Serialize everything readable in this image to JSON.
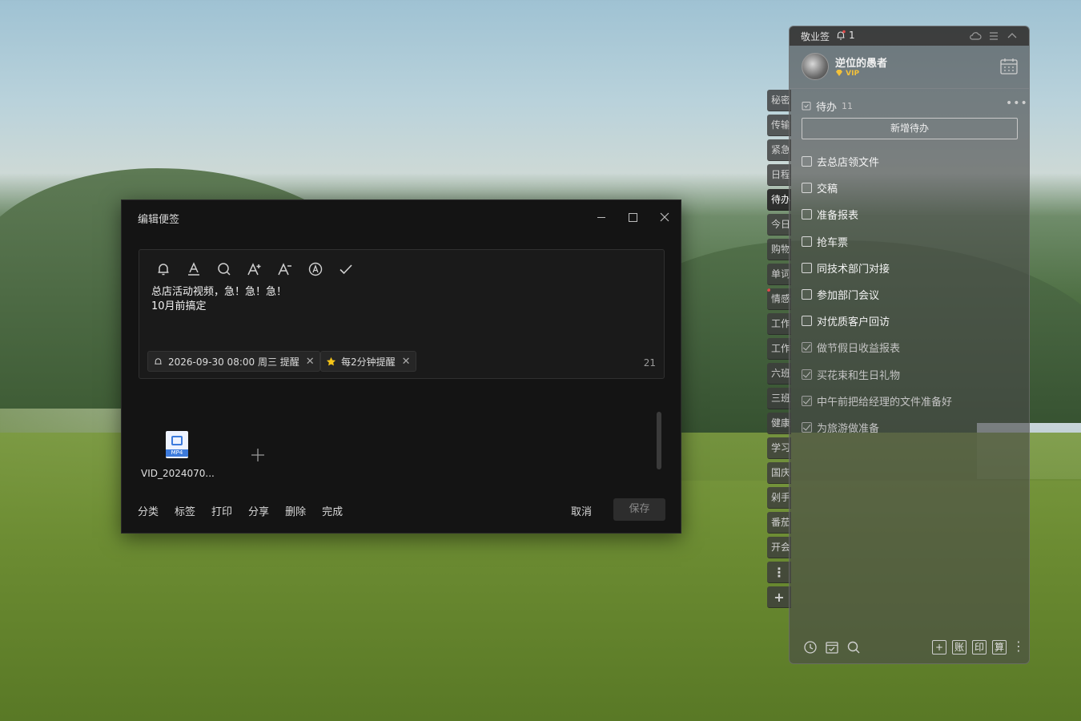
{
  "editor": {
    "title": "编辑便签",
    "note_lines": [
      "总店活动视频，急！急！急！",
      "10月前搞定"
    ],
    "reminder_chip": "2026-09-30 08:00 周三 提醒",
    "repeat_chip": "每2分钟提醒",
    "char_count": "21",
    "attachment_name": "VID_2024070...",
    "attachment_type": "MP4",
    "toolbar_icons": [
      "bell-icon",
      "font-color-icon",
      "search-icon",
      "font-increase-icon",
      "font-decrease-icon",
      "format-icon",
      "check-icon"
    ],
    "footer": {
      "category": "分类",
      "tags": "标签",
      "print": "打印",
      "share": "分享",
      "delete": "删除",
      "complete": "完成",
      "cancel": "取消",
      "save": "保存"
    }
  },
  "side_tabs": [
    "秘密",
    "传输",
    "紧急",
    "日程",
    "待办",
    "今日",
    "购物",
    "单词",
    "情感",
    "工作",
    "工作",
    "六班",
    "三班",
    "健康",
    "学习",
    "国庆",
    "剁手",
    "番茄",
    "开会"
  ],
  "side_tabs_active_index": 4,
  "panel": {
    "app_name": "敬业签",
    "bell_count": "1",
    "username": "逆位的愚者",
    "vip": "VIP",
    "todo_label": "待办",
    "todo_count": "11",
    "new_todo": "新增待办",
    "todos": [
      {
        "text": "去总店领文件",
        "done": false
      },
      {
        "text": "交稿",
        "done": false
      },
      {
        "text": "准备报表",
        "done": false
      },
      {
        "text": "抢车票",
        "done": false
      },
      {
        "text": "同技术部门对接",
        "done": false
      },
      {
        "text": "参加部门会议",
        "done": false
      },
      {
        "text": "对优质客户回访",
        "done": false
      },
      {
        "text": "做节假日收益报表",
        "done": true
      },
      {
        "text": "买花束和生日礼物",
        "done": true
      },
      {
        "text": "中午前把给经理的文件准备好",
        "done": true
      },
      {
        "text": "为旅游做准备",
        "done": true
      }
    ],
    "footer_boxes": [
      "+",
      "账",
      "印",
      "算"
    ]
  },
  "colors": {
    "editor_bg": "#141414",
    "panel_bg": "#484848",
    "vip_gold": "#f3c13a",
    "star": "#f5c518"
  }
}
